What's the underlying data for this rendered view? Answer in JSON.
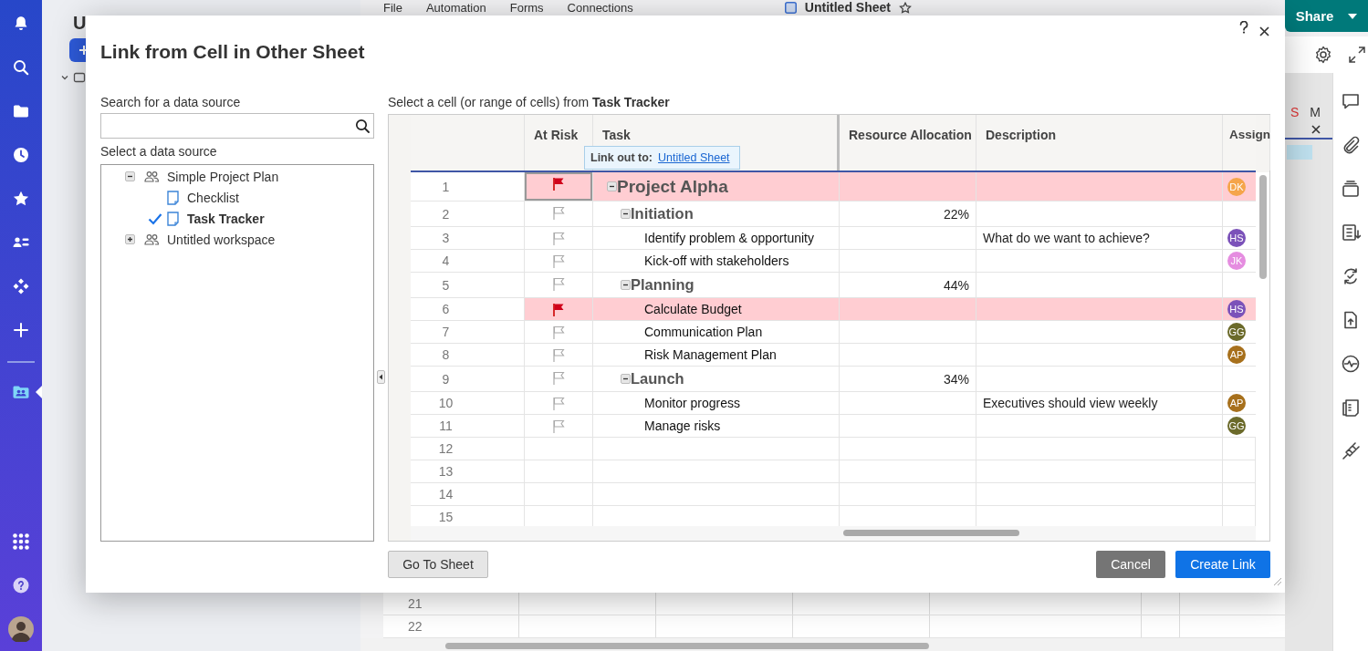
{
  "nav_rail": {
    "items": [
      {
        "kind": "notifications",
        "selected": false
      },
      {
        "kind": "search",
        "selected": false
      },
      {
        "kind": "browse",
        "selected": false
      },
      {
        "kind": "recents",
        "selected": false
      },
      {
        "kind": "favorites",
        "selected": false
      },
      {
        "kind": "contacts",
        "selected": false
      },
      {
        "kind": "solutions",
        "selected": false
      },
      {
        "kind": "create",
        "selected": false
      },
      {
        "kind": "workspaces",
        "selected": true
      },
      {
        "kind": "launcher",
        "selected": false
      },
      {
        "kind": "help",
        "selected": false
      },
      {
        "kind": "account",
        "selected": false
      }
    ]
  },
  "left_panel": {
    "title": "U"
  },
  "menu_bar": {
    "items": [
      "File",
      "Automation",
      "Forms",
      "Connections"
    ]
  },
  "sheet_title": "Untitled Sheet",
  "share_button": {
    "label": "Share"
  },
  "gantt": {
    "days": [
      {
        "label": "S",
        "weekend": true
      },
      {
        "label": "M",
        "weekend": false
      }
    ]
  },
  "background_rows": [
    "21",
    "22"
  ],
  "dialog": {
    "title": "Link from Cell in Other Sheet",
    "search": {
      "label": "Search for a data source"
    },
    "source_label": "Select a data source",
    "sources": [
      {
        "label": "Simple Project Plan",
        "kind": "workspace",
        "expanded": true,
        "selected": false,
        "children": [
          {
            "label": "Checklist",
            "kind": "sheet",
            "selected": false
          },
          {
            "label": "Task Tracker",
            "kind": "sheet",
            "selected": true
          }
        ]
      },
      {
        "label": "Untitled workspace",
        "kind": "workspace",
        "expanded": false,
        "selected": false
      }
    ],
    "cell_prompt": "Select a cell (or range of cells) from **Task Tracker**",
    "grid": {
      "columns": [
        "At Risk",
        "Task",
        "Resource Allocation",
        "Description",
        "Assign"
      ],
      "rows": [
        {
          "number": "1",
          "kind": "project",
          "task": "Project Alpha",
          "at_risk": true,
          "selected": true,
          "expanded": true,
          "assignee": {
            "initials": "DK",
            "color": "#f5a54a"
          },
          "children": [
            {
              "number": "2",
              "kind": "phase",
              "task": "Initiation",
              "at_risk": false,
              "selected": false,
              "expanded": true,
              "resource": "22%",
              "children": [
                {
                  "number": "3",
                  "kind": "task",
                  "task": "Identify problem & opportunity",
                  "at_risk": false,
                  "selected": false,
                  "description": "What do we want to achieve?",
                  "assignee": {
                    "initials": "HS",
                    "color": "#7b52b9"
                  }
                },
                {
                  "number": "4",
                  "kind": "task",
                  "task": "Kick-off with stakeholders",
                  "at_risk": false,
                  "selected": false,
                  "assignee": {
                    "initials": "JK",
                    "color": "#e58de0"
                  }
                }
              ]
            },
            {
              "number": "5",
              "kind": "phase",
              "task": "Planning",
              "at_risk": false,
              "selected": false,
              "expanded": true,
              "resource": "44%",
              "children": [
                {
                  "number": "6",
                  "kind": "task",
                  "task": "Calculate Budget",
                  "at_risk": true,
                  "selected": false,
                  "assignee": {
                    "initials": "HS",
                    "color": "#7b52b9"
                  }
                },
                {
                  "number": "7",
                  "kind": "task",
                  "task": "Communication Plan",
                  "at_risk": false,
                  "selected": false,
                  "assignee": {
                    "initials": "GG",
                    "color": "#6b6a2a"
                  }
                },
                {
                  "number": "8",
                  "kind": "task",
                  "task": "Risk Management Plan",
                  "at_risk": false,
                  "selected": false,
                  "assignee": {
                    "initials": "AP",
                    "color": "#a7701c"
                  }
                }
              ]
            },
            {
              "number": "9",
              "kind": "phase",
              "task": "Launch",
              "at_risk": false,
              "selected": false,
              "expanded": true,
              "resource": "34%",
              "children": [
                {
                  "number": "10",
                  "kind": "task",
                  "task": "Monitor progress",
                  "at_risk": false,
                  "selected": false,
                  "description": "Executives should view weekly",
                  "assignee": {
                    "initials": "AP",
                    "color": "#a7701c"
                  }
                },
                {
                  "number": "11",
                  "kind": "task",
                  "task": "Manage risks",
                  "at_risk": false,
                  "selected": false,
                  "assignee": {
                    "initials": "GG",
                    "color": "#6b6a2a"
                  }
                }
              ]
            }
          ]
        }
      ],
      "empty_rows": [
        "12",
        "13",
        "14",
        "15"
      ]
    },
    "tooltip": {
      "label": "Link out to:",
      "link": "Untitled Sheet"
    },
    "buttons": [
      {
        "label": "Go To Sheet",
        "kind": "secondary"
      },
      {
        "label": "Cancel",
        "kind": "neutral"
      },
      {
        "label": "Create Link",
        "kind": "primary"
      }
    ]
  }
}
